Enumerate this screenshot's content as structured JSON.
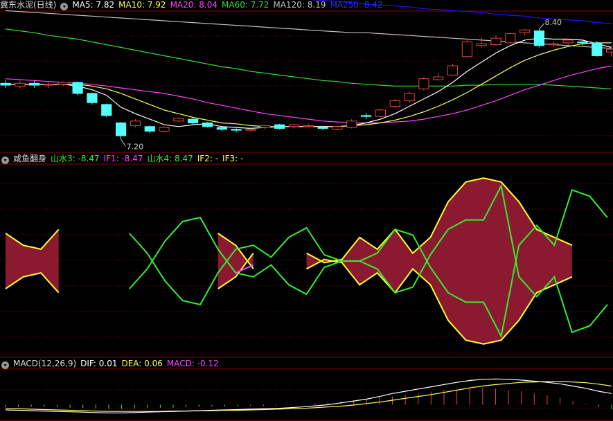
{
  "colors": {
    "bg": "#000000",
    "border": "#8b0000",
    "grid": "#7a1010",
    "up": "#e8483a",
    "down": "#54ffff",
    "ma5": "#ffffff",
    "ma10": "#ffff55",
    "ma20": "#ff44ff",
    "ma60": "#33dd33",
    "ma120": "#c0c0c0",
    "ma250": "#1818ff",
    "fill": "#8b1a30",
    "edge": "#ffff33",
    "green": "#33ee33",
    "magenta": "#ff44ff"
  },
  "panel1": {
    "legend": {
      "title": "冀东水泥(日线)",
      "ma5": "MA5: 7.82",
      "ma10": "MA10: 7.92",
      "ma20": "MA20: 8.04",
      "ma60": "MA60: 7.72",
      "ma120": "MA120: 8.19",
      "ma250": "MA250: 8.42"
    },
    "high_label": "8.40",
    "low_label": "7.20"
  },
  "panel2": {
    "legend": {
      "title": "咸鱼翻身",
      "s3": "山水3: -8.47",
      "if1": "IF1: -8.47",
      "s4": "山水4: 8.47",
      "if2": "IF2: -",
      "if3": "IF3: -"
    }
  },
  "panel3": {
    "legend": {
      "title": "MACD(12,26,9)",
      "dif": "DIF: 0.01",
      "dea": "DEA: 0.06",
      "macd": "MACD: -0.12"
    }
  },
  "chart_data": [
    {
      "type": "candlestick",
      "ylim": [
        7.12,
        8.55
      ],
      "annotations": [
        {
          "text": "8.40",
          "value": 8.4,
          "index": 37
        },
        {
          "text": "7.20",
          "value": 7.2,
          "index": 8
        }
      ],
      "candles": [
        {
          "o": 7.81,
          "c": 7.79,
          "h": 7.84,
          "l": 7.76
        },
        {
          "o": 7.78,
          "c": 7.81,
          "h": 7.84,
          "l": 7.76
        },
        {
          "o": 7.81,
          "c": 7.79,
          "h": 7.84,
          "l": 7.76
        },
        {
          "o": 7.79,
          "c": 7.8,
          "h": 7.82,
          "l": 7.76
        },
        {
          "o": 7.8,
          "c": 7.82,
          "h": 7.83,
          "l": 7.78
        },
        {
          "o": 7.82,
          "c": 7.7,
          "h": 7.83,
          "l": 7.68
        },
        {
          "o": 7.7,
          "c": 7.6,
          "h": 7.71,
          "l": 7.58
        },
        {
          "o": 7.58,
          "c": 7.46,
          "h": 7.59,
          "l": 7.44
        },
        {
          "o": 7.38,
          "c": 7.24,
          "h": 7.39,
          "l": 7.2
        },
        {
          "o": 7.35,
          "c": 7.4,
          "h": 7.42,
          "l": 7.33
        },
        {
          "o": 7.34,
          "c": 7.29,
          "h": 7.35,
          "l": 7.27
        },
        {
          "o": 7.29,
          "c": 7.33,
          "h": 7.34,
          "l": 7.28
        },
        {
          "o": 7.4,
          "c": 7.43,
          "h": 7.44,
          "l": 7.39
        },
        {
          "o": 7.42,
          "c": 7.38,
          "h": 7.43,
          "l": 7.36
        },
        {
          "o": 7.38,
          "c": 7.34,
          "h": 7.39,
          "l": 7.33
        },
        {
          "o": 7.33,
          "c": 7.31,
          "h": 7.34,
          "l": 7.29
        },
        {
          "o": 7.31,
          "c": 7.3,
          "h": 7.32,
          "l": 7.28
        },
        {
          "o": 7.3,
          "c": 7.31,
          "h": 7.33,
          "l": 7.29
        },
        {
          "o": 7.33,
          "c": 7.35,
          "h": 7.36,
          "l": 7.31
        },
        {
          "o": 7.36,
          "c": 7.32,
          "h": 7.37,
          "l": 7.31
        },
        {
          "o": 7.34,
          "c": 7.36,
          "h": 7.37,
          "l": 7.32
        },
        {
          "o": 7.34,
          "c": 7.35,
          "h": 7.37,
          "l": 7.33
        },
        {
          "o": 7.33,
          "c": 7.32,
          "h": 7.35,
          "l": 7.3
        },
        {
          "o": 7.31,
          "c": 7.34,
          "h": 7.35,
          "l": 7.3
        },
        {
          "o": 7.33,
          "c": 7.4,
          "h": 7.42,
          "l": 7.32
        },
        {
          "o": 7.46,
          "c": 7.45,
          "h": 7.49,
          "l": 7.42
        },
        {
          "o": 7.45,
          "c": 7.52,
          "h": 7.53,
          "l": 7.44
        },
        {
          "o": 7.56,
          "c": 7.62,
          "h": 7.64,
          "l": 7.55
        },
        {
          "o": 7.62,
          "c": 7.7,
          "h": 7.72,
          "l": 7.6
        },
        {
          "o": 7.75,
          "c": 7.86,
          "h": 7.88,
          "l": 7.73
        },
        {
          "o": 7.85,
          "c": 7.88,
          "h": 7.92,
          "l": 7.84
        },
        {
          "o": 7.9,
          "c": 8.0,
          "h": 8.02,
          "l": 7.89
        },
        {
          "o": 8.1,
          "c": 8.26,
          "h": 8.28,
          "l": 8.09
        },
        {
          "o": 8.22,
          "c": 8.24,
          "h": 8.31,
          "l": 8.2
        },
        {
          "o": 8.23,
          "c": 8.3,
          "h": 8.33,
          "l": 8.22
        },
        {
          "o": 8.25,
          "c": 8.35,
          "h": 8.36,
          "l": 8.24
        },
        {
          "o": 8.36,
          "c": 8.39,
          "h": 8.4,
          "l": 8.33
        },
        {
          "o": 8.38,
          "c": 8.22,
          "h": 8.4,
          "l": 8.2
        },
        {
          "o": 8.23,
          "c": 8.24,
          "h": 8.27,
          "l": 8.2
        },
        {
          "o": 8.25,
          "c": 8.28,
          "h": 8.29,
          "l": 8.23
        },
        {
          "o": 8.26,
          "c": 8.25,
          "h": 8.27,
          "l": 8.22
        },
        {
          "o": 8.25,
          "c": 8.11,
          "h": 8.27,
          "l": 8.1
        },
        {
          "o": 8.15,
          "c": 8.18,
          "h": 8.22,
          "l": 8.1
        }
      ],
      "series": [
        {
          "key": "ma5",
          "values": [
            7.8,
            7.8,
            7.8,
            7.8,
            7.8,
            7.78,
            7.74,
            7.68,
            7.55,
            7.48,
            7.42,
            7.36,
            7.34,
            7.36,
            7.37,
            7.34,
            7.33,
            7.32,
            7.33,
            7.34,
            7.34,
            7.34,
            7.34,
            7.34,
            7.35,
            7.38,
            7.42,
            7.48,
            7.56,
            7.64,
            7.72,
            7.82,
            7.94,
            8.04,
            8.14,
            8.22,
            8.28,
            8.3,
            8.29,
            8.29,
            8.28,
            8.24,
            8.2
          ]
        },
        {
          "key": "ma10",
          "values": [
            7.8,
            7.8,
            7.8,
            7.8,
            7.8,
            7.8,
            7.78,
            7.75,
            7.7,
            7.64,
            7.58,
            7.52,
            7.48,
            7.44,
            7.41,
            7.38,
            7.37,
            7.35,
            7.34,
            7.34,
            7.34,
            7.34,
            7.34,
            7.34,
            7.35,
            7.36,
            7.38,
            7.41,
            7.45,
            7.5,
            7.56,
            7.63,
            7.71,
            7.8,
            7.89,
            7.98,
            8.06,
            8.12,
            8.17,
            8.21,
            8.24,
            8.25,
            8.25
          ]
        },
        {
          "key": "ma20",
          "values": [
            7.86,
            7.85,
            7.84,
            7.83,
            7.82,
            7.81,
            7.8,
            7.78,
            7.76,
            7.74,
            7.72,
            7.7,
            7.67,
            7.64,
            7.6,
            7.57,
            7.54,
            7.51,
            7.48,
            7.46,
            7.44,
            7.42,
            7.4,
            7.39,
            7.38,
            7.38,
            7.38,
            7.39,
            7.4,
            7.42,
            7.45,
            7.48,
            7.52,
            7.57,
            7.62,
            7.68,
            7.74,
            7.79,
            7.84,
            7.89,
            7.93,
            7.97,
            8.0
          ]
        },
        {
          "key": "ma60",
          "values": [
            8.4,
            8.38,
            8.36,
            8.33,
            8.31,
            8.29,
            8.26,
            8.23,
            8.2,
            8.17,
            8.14,
            8.11,
            8.08,
            8.05,
            8.02,
            7.99,
            7.97,
            7.94,
            7.92,
            7.9,
            7.88,
            7.86,
            7.84,
            7.83,
            7.81,
            7.8,
            7.79,
            7.78,
            7.78,
            7.78,
            7.78,
            7.78,
            7.79,
            7.79,
            7.8,
            7.8,
            7.8,
            7.8,
            7.79,
            7.78,
            7.77,
            7.76,
            7.75
          ]
        },
        {
          "key": "ma120",
          "values": [
            8.6,
            8.59,
            8.58,
            8.57,
            8.56,
            8.55,
            8.54,
            8.53,
            8.52,
            8.51,
            8.5,
            8.49,
            8.48,
            8.47,
            8.46,
            8.45,
            8.44,
            8.43,
            8.42,
            8.41,
            8.4,
            8.39,
            8.38,
            8.37,
            8.36,
            8.36,
            8.35,
            8.34,
            8.33,
            8.32,
            8.31,
            8.3,
            8.29,
            8.28,
            8.27,
            8.26,
            8.25,
            8.24,
            8.23,
            8.22,
            8.21,
            8.2,
            8.19
          ]
        },
        {
          "key": "ma250",
          "values": [
            8.98,
            8.97,
            8.96,
            8.95,
            8.94,
            8.93,
            8.91,
            8.9,
            8.89,
            8.88,
            8.86,
            8.85,
            8.84,
            8.83,
            8.81,
            8.8,
            8.79,
            8.77,
            8.76,
            8.75,
            8.74,
            8.72,
            8.71,
            8.7,
            8.69,
            8.67,
            8.66,
            8.65,
            8.64,
            8.62,
            8.61,
            8.6,
            8.59,
            8.58,
            8.56,
            8.55,
            8.54,
            8.52,
            8.51,
            8.5,
            8.49,
            8.47,
            8.46
          ]
        }
      ]
    },
    {
      "type": "area",
      "ylim": [
        -12,
        12
      ],
      "series": [
        {
          "key": "s3",
          "color": "green",
          "values": [
            null,
            null,
            null,
            null,
            null,
            null,
            null,
            -3.5,
            -1,
            2.5,
            5,
            5.5,
            1.5,
            -1.5,
            -2,
            -0.5,
            -3,
            -4.2,
            -0.8,
            0,
            0,
            -1,
            -4,
            -3.3,
            0.8,
            4,
            5.2,
            5.2,
            9.5,
            -2,
            -4.5,
            -2,
            -9,
            -8.2,
            -5.5
          ]
        },
        {
          "key": "s4",
          "color": "green",
          "values": [
            null,
            null,
            null,
            null,
            null,
            null,
            null,
            3.5,
            1,
            -2.5,
            -5,
            -5.5,
            -1.5,
            1.5,
            2,
            0.5,
            3,
            4.2,
            0.8,
            0,
            0,
            1,
            4,
            3.3,
            -0.8,
            -4,
            -5.2,
            -5.2,
            -9.5,
            2,
            4.5,
            2,
            9,
            8.2,
            5.5
          ]
        },
        {
          "key": "if1",
          "color": "magenta",
          "values": [
            null,
            null,
            null,
            null,
            null,
            null,
            null,
            null,
            null,
            null,
            null,
            null,
            null,
            -1.5,
            -0.5,
            null,
            null,
            null,
            null,
            null,
            null,
            null,
            null,
            null,
            null,
            null,
            null,
            null,
            null,
            null,
            null,
            null,
            null,
            null,
            null
          ]
        },
        {
          "key": "band_upper",
          "color": "fill",
          "values": [
            3.5,
            2,
            1.5,
            4,
            null,
            null,
            null,
            null,
            null,
            null,
            null,
            null,
            3.5,
            2,
            -1,
            null,
            null,
            1,
            -0.2,
            0.2,
            3,
            1.5,
            4,
            1,
            3,
            7.5,
            10,
            10.5,
            10,
            7.5,
            4,
            3,
            2,
            null,
            null
          ]
        },
        {
          "key": "band_lower",
          "color": "fill",
          "values": [
            -3.5,
            -2,
            -1.5,
            -4,
            null,
            null,
            null,
            null,
            null,
            null,
            null,
            null,
            -3.5,
            -2,
            1,
            null,
            null,
            -1,
            0.2,
            -0.2,
            -3,
            -1.5,
            -4,
            -1,
            -3,
            -7.5,
            -10,
            -10.5,
            -10,
            -7.5,
            -4,
            -3,
            -2,
            null,
            null
          ]
        }
      ]
    },
    {
      "type": "bar",
      "ylim": [
        -0.4,
        0.9
      ],
      "histogram": [
        -0.06,
        -0.06,
        -0.05,
        -0.06,
        -0.07,
        -0.08,
        -0.09,
        -0.1,
        -0.11,
        -0.11,
        -0.1,
        -0.09,
        -0.08,
        -0.08,
        -0.07,
        -0.06,
        -0.05,
        -0.05,
        -0.04,
        -0.03,
        -0.03,
        -0.02,
        -0.01,
        0.01,
        0.04,
        0.06,
        0.09,
        0.12,
        0.16,
        0.19,
        0.22,
        0.26,
        0.3,
        0.35,
        0.4,
        0.42,
        0.45,
        0.45,
        0.43,
        0.4,
        0.36,
        0.3,
        0.25,
        0.18,
        0.1,
        0.02,
        -0.06,
        -0.12
      ],
      "dif": [
        -0.14,
        -0.15,
        -0.16,
        -0.17,
        -0.18,
        -0.19,
        -0.2,
        -0.21,
        -0.22,
        -0.22,
        -0.21,
        -0.2,
        -0.19,
        -0.18,
        -0.17,
        -0.16,
        -0.15,
        -0.14,
        -0.13,
        -0.12,
        -0.11,
        -0.1,
        -0.08,
        -0.06,
        -0.03,
        0.0,
        0.05,
        0.1,
        0.15,
        0.22,
        0.3,
        0.36,
        0.42,
        0.48,
        0.54,
        0.6,
        0.65,
        0.68,
        0.69,
        0.68,
        0.66,
        0.63,
        0.6,
        0.56,
        0.5,
        0.44,
        0.36,
        0.3
      ],
      "dea": [
        -0.1,
        -0.11,
        -0.12,
        -0.13,
        -0.14,
        -0.15,
        -0.16,
        -0.17,
        -0.18,
        -0.18,
        -0.18,
        -0.18,
        -0.18,
        -0.17,
        -0.17,
        -0.16,
        -0.16,
        -0.15,
        -0.15,
        -0.14,
        -0.13,
        -0.12,
        -0.11,
        -0.1,
        -0.08,
        -0.06,
        -0.04,
        -0.01,
        0.03,
        0.07,
        0.12,
        0.17,
        0.22,
        0.27,
        0.33,
        0.39,
        0.45,
        0.5,
        0.54,
        0.57,
        0.6,
        0.61,
        0.62,
        0.62,
        0.61,
        0.59,
        0.55,
        0.5
      ]
    }
  ]
}
